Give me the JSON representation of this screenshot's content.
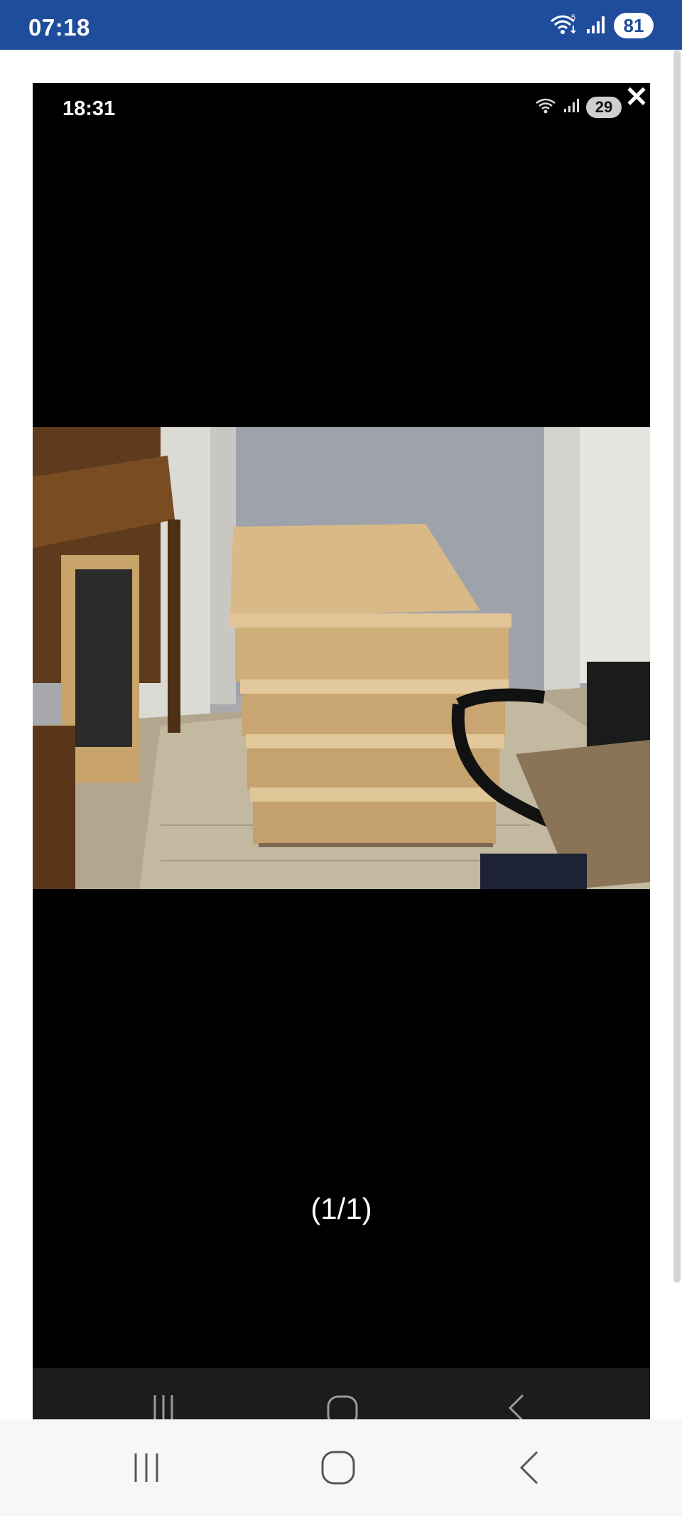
{
  "status_bar": {
    "time": "07:18",
    "battery": "81",
    "wifi_badge": "5",
    "icons": [
      "wifi-icon",
      "signal-icon",
      "battery-icon"
    ],
    "background": "#1f4d9b"
  },
  "viewer": {
    "close_icon": "close-icon",
    "inner_status": {
      "time": "18:31",
      "battery": "29",
      "icons": [
        "wifi-icon",
        "signal-icon",
        "battery-icon"
      ]
    },
    "photo": "photo of a light wooden four-drawer chest in a hallway",
    "counter": "(1/1)",
    "inner_nav_icons": [
      "recents-icon",
      "home-icon",
      "back-icon"
    ]
  },
  "system_nav": {
    "icons": [
      "recents-icon",
      "home-icon",
      "back-icon"
    ]
  }
}
